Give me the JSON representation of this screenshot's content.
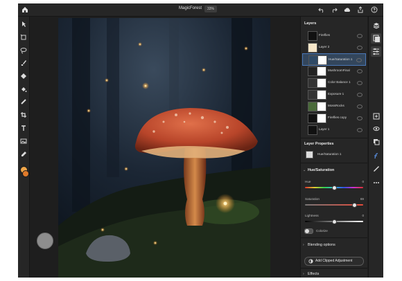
{
  "app": {
    "document_title": "MagicForest",
    "zoom": "33%"
  },
  "layers_panel": {
    "title": "Layers",
    "layers": [
      {
        "name": "Fireflies",
        "selected": false
      },
      {
        "name": "Layer 2",
        "selected": false
      },
      {
        "name": "Hue/Saturation 1",
        "selected": true
      },
      {
        "name": "MushroomFinal",
        "selected": false
      },
      {
        "name": "Color Balance 1",
        "selected": false
      },
      {
        "name": "Exposure 1",
        "selected": false
      },
      {
        "name": "MossRocks",
        "selected": false
      },
      {
        "name": "Fireflies copy",
        "selected": false
      },
      {
        "name": "Layer 1",
        "selected": false
      }
    ]
  },
  "layer_properties": {
    "title": "Layer Properties",
    "layer_name": "Hue/Saturation 1",
    "adjustment_title": "Hue/Saturation",
    "hue": {
      "label": "Hue",
      "value": "0",
      "fraction": 0.5
    },
    "saturation": {
      "label": "Saturation",
      "value": "69",
      "fraction": 0.85
    },
    "lightness": {
      "label": "Lightness",
      "value": "0",
      "fraction": 0.5
    },
    "colorize_label": "Colorize",
    "blending_label": "Blending options",
    "add_clipped_label": "Add Clipped Adjustment",
    "effects_label": "Effects"
  },
  "colors": {
    "accent": "#4a78b8",
    "foreground_swatch": "#f0a64a",
    "background_swatch": "#e07a2a"
  }
}
